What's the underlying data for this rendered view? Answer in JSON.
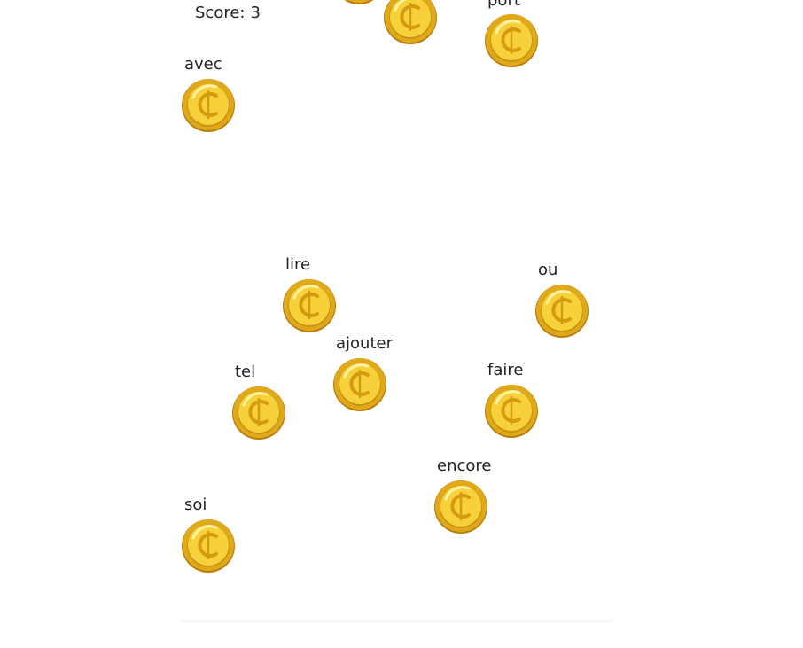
{
  "hud": {
    "score_label": "Score:",
    "score_value": "3"
  },
  "coins": [
    {
      "word": "",
      "name": "coin-partial-top"
    },
    {
      "word": "",
      "name": "coin-top-middle"
    },
    {
      "word": "port",
      "name": "coin-port"
    },
    {
      "word": "avec",
      "name": "coin-avec"
    },
    {
      "word": "lire",
      "name": "coin-lire"
    },
    {
      "word": "ou",
      "name": "coin-ou"
    },
    {
      "word": "ajouter",
      "name": "coin-ajouter"
    },
    {
      "word": "tel",
      "name": "coin-tel"
    },
    {
      "word": "faire",
      "name": "coin-faire"
    },
    {
      "word": "encore",
      "name": "coin-encore"
    },
    {
      "word": "soi",
      "name": "coin-soi"
    }
  ],
  "colors": {
    "coin_outer": "#e0a91a",
    "coin_face": "#f7d13a",
    "coin_highlight": "#fff3a6",
    "coin_shadow": "#b77f0e",
    "coin_symbol": "#d49a12",
    "text": "#222222"
  },
  "icons": {
    "coin": "gold-coin-cent-icon"
  }
}
